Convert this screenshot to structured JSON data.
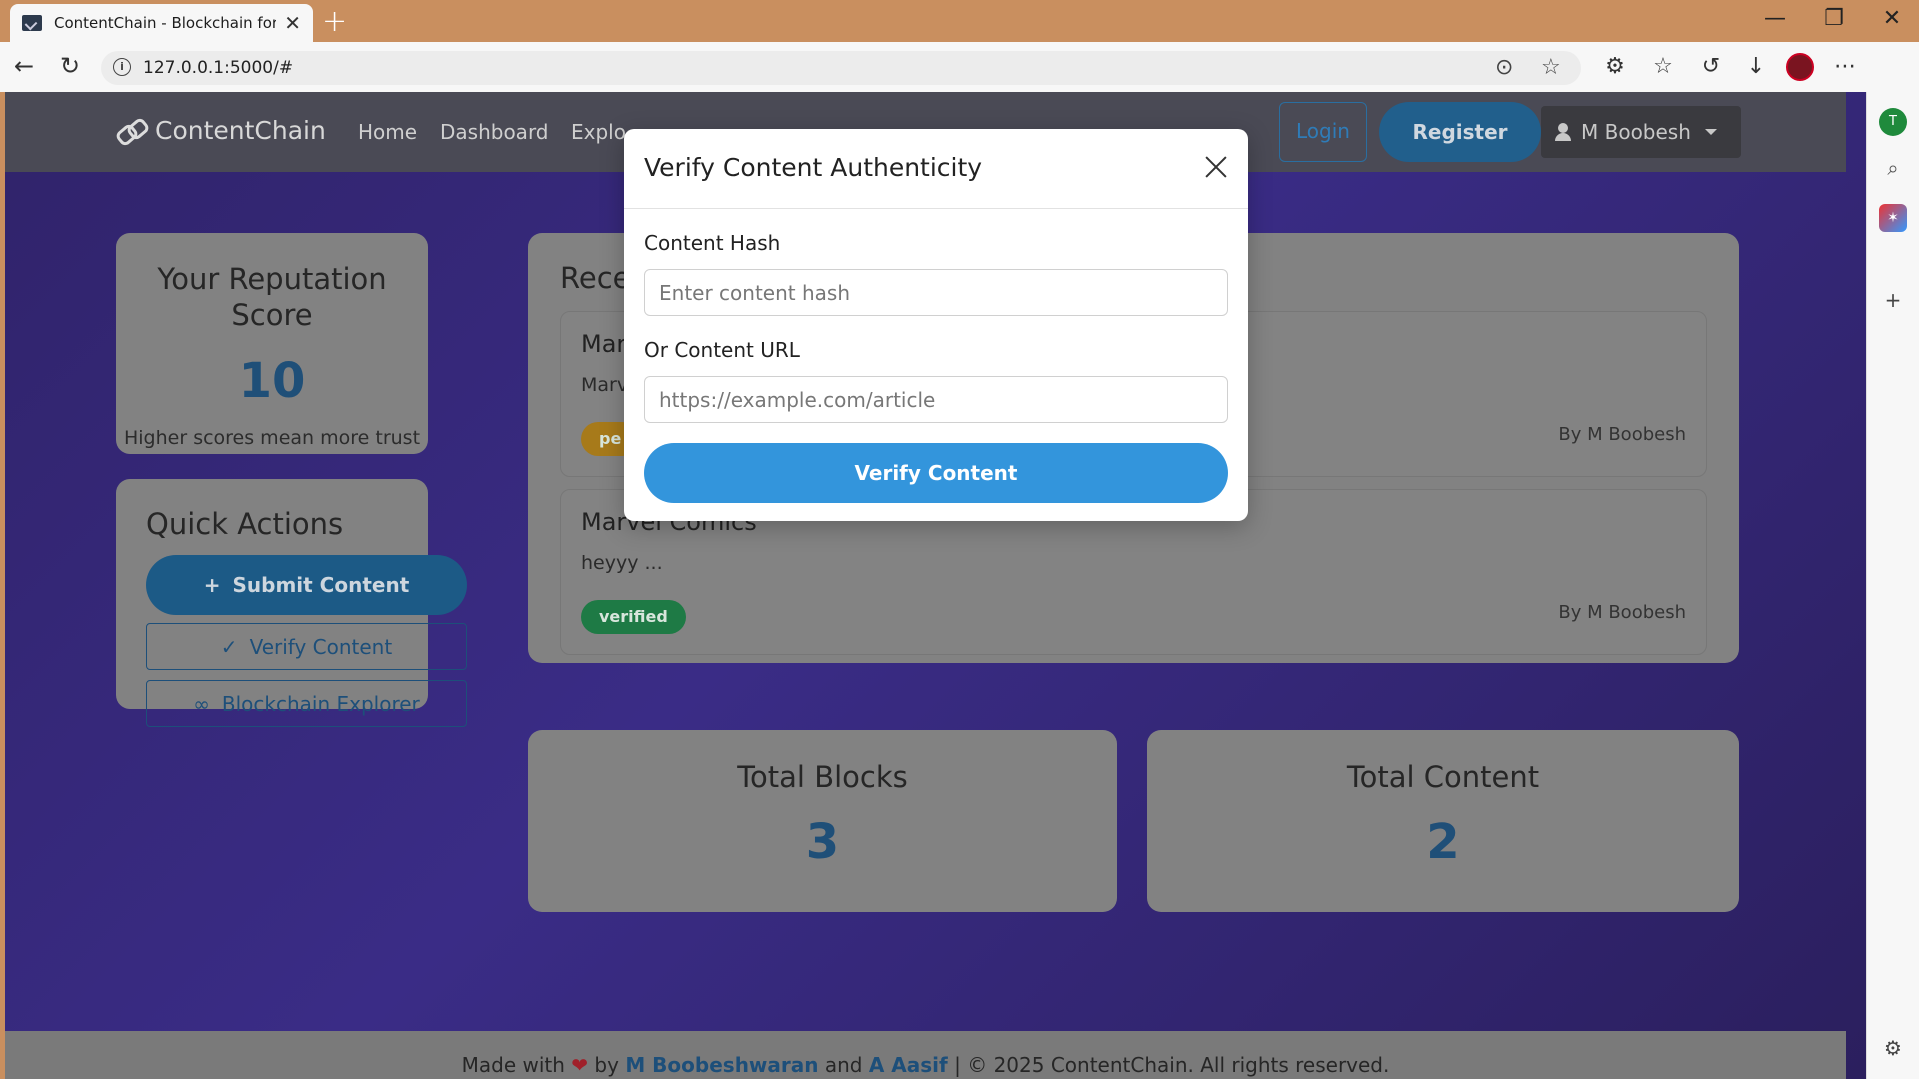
{
  "browser": {
    "tab_title": "ContentChain - Blockchain for Co",
    "new_tab": "+",
    "url": "127.0.0.1:5000/#",
    "window_controls": [
      "—",
      "❐",
      "✕"
    ]
  },
  "site": {
    "brand": "ContentChain",
    "nav": [
      "Home",
      "Dashboard",
      "Explo"
    ],
    "login": "Login",
    "register": "Register",
    "user": "M Boobesh"
  },
  "reputation": {
    "title": "Your Reputation Score",
    "score": "10",
    "description": "Higher scores mean more trust"
  },
  "quick_actions": {
    "title": "Quick Actions",
    "submit": "Submit Content",
    "verify": "Verify Content",
    "explorer": "Blockchain Explorer"
  },
  "recent": {
    "title": "Rece",
    "items": [
      {
        "title": "Mar",
        "body": "Marv",
        "badge": "pe",
        "badge_color": "#a77a1a",
        "author": "By M Boobesh"
      },
      {
        "title": "Marvel Comics",
        "body": "heyyy ...",
        "badge": "verified",
        "badge_color": "#1e7a45",
        "author": "By M Boobesh"
      }
    ]
  },
  "stats": {
    "blocks_label": "Total Blocks",
    "blocks_value": "3",
    "content_label": "Total Content",
    "content_value": "2"
  },
  "footer": {
    "made_with": "Made with",
    "heart": "❤",
    "by": "by",
    "author1": "M Boobeshwaran",
    "and": "and",
    "author2": "A Aasif",
    "copyright": "| © 2025 ContentChain. All rights reserved."
  },
  "modal": {
    "title": "Verify Content Authenticity",
    "hash_label": "Content Hash",
    "hash_placeholder": "Enter content hash",
    "url_label": "Or Content URL",
    "url_placeholder": "https://example.com/article",
    "button": "Verify Content"
  },
  "colors": {
    "accent": "#3395dc",
    "brand_dark": "#1f4f78",
    "verified": "#1e7a45",
    "pending": "#a77a1a"
  }
}
